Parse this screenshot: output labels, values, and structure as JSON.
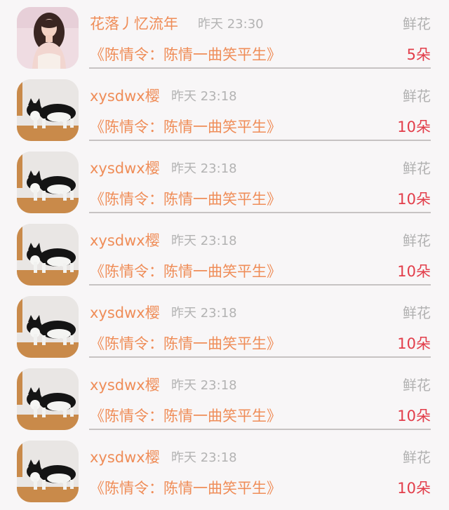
{
  "gifts": [
    {
      "user": "花落丿忆流年",
      "time": "昨天 23:30",
      "type": "鲜花",
      "work": "《陈情令：陈情一曲笑平生》",
      "count": "5朵",
      "avatar": "woman-avatar"
    },
    {
      "user": "xysdwx樱",
      "time": "昨天 23:18",
      "type": "鲜花",
      "work": "《陈情令：陈情一曲笑平生》",
      "count": "10朵",
      "avatar": "cat-avatar"
    },
    {
      "user": "xysdwx樱",
      "time": "昨天 23:18",
      "type": "鲜花",
      "work": "《陈情令：陈情一曲笑平生》",
      "count": "10朵",
      "avatar": "cat-avatar"
    },
    {
      "user": "xysdwx樱",
      "time": "昨天 23:18",
      "type": "鲜花",
      "work": "《陈情令：陈情一曲笑平生》",
      "count": "10朵",
      "avatar": "cat-avatar"
    },
    {
      "user": "xysdwx樱",
      "time": "昨天 23:18",
      "type": "鲜花",
      "work": "《陈情令：陈情一曲笑平生》",
      "count": "10朵",
      "avatar": "cat-avatar"
    },
    {
      "user": "xysdwx樱",
      "time": "昨天 23:18",
      "type": "鲜花",
      "work": "《陈情令：陈情一曲笑平生》",
      "count": "10朵",
      "avatar": "cat-avatar"
    },
    {
      "user": "xysdwx樱",
      "time": "昨天 23:18",
      "type": "鲜花",
      "work": "《陈情令：陈情一曲笑平生》",
      "count": "10朵",
      "avatar": "cat-avatar"
    }
  ]
}
